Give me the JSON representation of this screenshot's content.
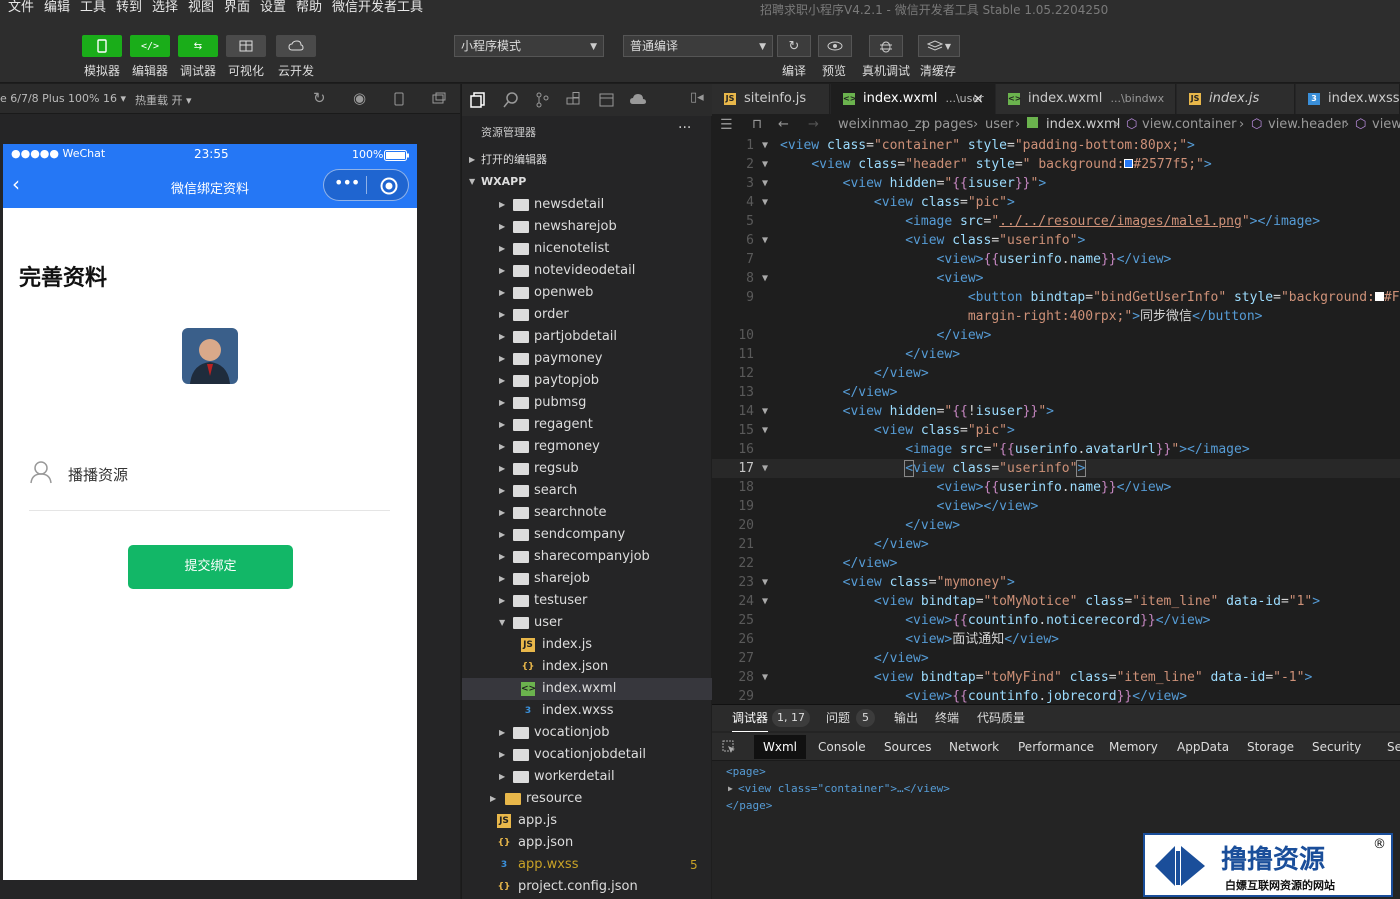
{
  "menu": [
    "文件",
    "编辑",
    "工具",
    "转到",
    "选择",
    "视图",
    "界面",
    "设置",
    "帮助",
    "微信开发者工具"
  ],
  "window_title": "招聘求职小程序V4.2.1 - 微信开发者工具 Stable 1.05.2204250",
  "toolbar": {
    "left_buttons": [
      "模拟器",
      "编辑器",
      "调试器",
      "可视化",
      "云开发"
    ],
    "mode_select": "小程序模式",
    "compile_select": "普通编译",
    "right_labels": [
      "编译",
      "预览",
      "真机调试",
      "清缓存"
    ]
  },
  "simulator": {
    "device_bar": "e 6/7/8 Plus 100% 16 ▾",
    "hotreload": "热重载 开 ▾",
    "status": {
      "carrier": "●●●●● WeChat",
      "time": "23:55",
      "battery": "100%"
    },
    "nav_title": "微信绑定资料",
    "page_heading": "完善资料",
    "username": "播播资源",
    "submit_button": "提交绑定",
    "nav_color": "#2577f5",
    "button_color": "#12b767"
  },
  "explorer": {
    "title": "资源管理器",
    "open_editors": "打开的编辑器",
    "project": "WXAPP",
    "folders": [
      "newsdetail",
      "newsharejob",
      "nicenotelist",
      "notevideodetail",
      "openweb",
      "order",
      "partjobdetail",
      "paymoney",
      "paytopjob",
      "pubmsg",
      "regagent",
      "regmoney",
      "regsub",
      "search",
      "searchnote",
      "sendcompany",
      "sharecompanyjob",
      "sharejob",
      "testuser"
    ],
    "user_folder": "user",
    "user_files": [
      "index.js",
      "index.json",
      "index.wxml",
      "index.wxss"
    ],
    "folders_after": [
      "vocationjob",
      "vocationjobdetail",
      "workerdetail"
    ],
    "resource": "resource",
    "root_files": [
      "app.js",
      "app.json",
      "app.wxss",
      "project.config.json"
    ],
    "app_wxss_badge": "5"
  },
  "editor": {
    "tabs": [
      {
        "name": "siteinfo.js",
        "suffix": ""
      },
      {
        "name": "index.wxml",
        "suffix": "...\\user"
      },
      {
        "name": "index.wxml",
        "suffix": "...\\bindwx"
      },
      {
        "name": "index.js",
        "suffix": ""
      },
      {
        "name": "index.wxss",
        "suffix": ""
      }
    ],
    "breadcrumb": [
      "weixinmao_zp",
      "pages",
      "user",
      "index.wxml",
      "view.container",
      "view.header",
      "view"
    ],
    "current_line": "17"
  },
  "devtools": {
    "tabs": [
      {
        "label": "调试器",
        "badge": "1, 17"
      },
      {
        "label": "问题",
        "badge": "5"
      },
      {
        "label": "输出",
        "badge": ""
      },
      {
        "label": "终端",
        "badge": ""
      },
      {
        "label": "代码质量",
        "badge": ""
      }
    ],
    "panels": [
      "Wxml",
      "Console",
      "Sources",
      "Network",
      "Performance",
      "Memory",
      "AppData",
      "Storage",
      "Security",
      "Se"
    ],
    "dom": [
      "<page>",
      "<view class=\"container\">…</view>",
      "</page>"
    ]
  },
  "watermark": {
    "title": "撸撸资源",
    "subtitle": "白嫖互联网资源的网站",
    "mark": "®"
  }
}
